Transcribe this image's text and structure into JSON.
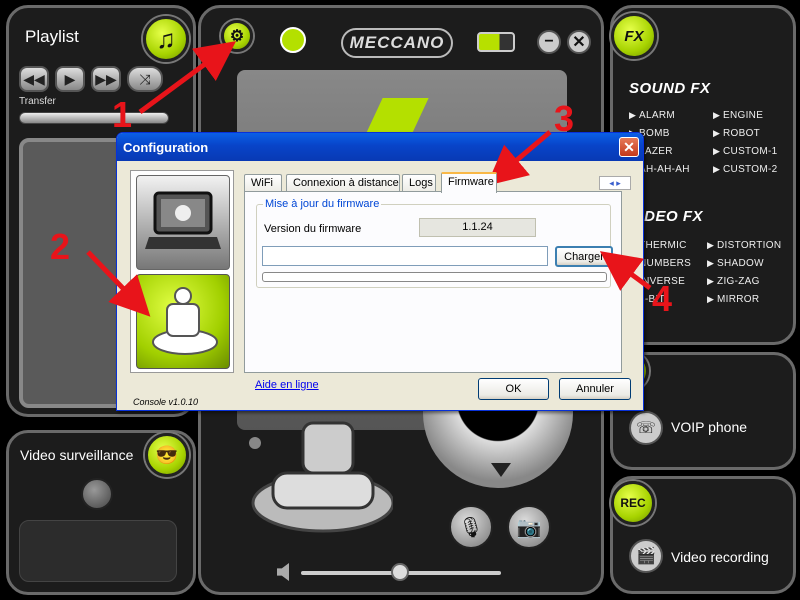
{
  "playlist": {
    "title": "Playlist",
    "transfer_label": "Transfer",
    "controls": [
      "rewind-icon",
      "play-icon",
      "fast-forward-icon",
      "shuffle-icon"
    ]
  },
  "surveillance": {
    "title": "Video surveillance"
  },
  "main": {
    "brand": "MECCANO",
    "battery_level": 0.6
  },
  "fx": {
    "sound_title": "SOUND FX",
    "sound_left": [
      "ALARM",
      "BOMB",
      "LAZER",
      "AH-AH-AH"
    ],
    "sound_right": [
      "ENGINE",
      "ROBOT",
      "CUSTOM-1",
      "CUSTOM-2"
    ],
    "video_title": "VIDEO FX",
    "video_left": [
      "THERMIC",
      "NUMBERS",
      "INVERSE",
      "8-BIT"
    ],
    "video_right": [
      "DISTORTION",
      "SHADOW",
      "ZIG-ZAG",
      "MIRROR"
    ],
    "badge": "FX"
  },
  "voip": {
    "label": "VOIP phone"
  },
  "rec": {
    "badge": "REC",
    "label": "Video recording"
  },
  "dialog": {
    "title": "Configuration",
    "close_symbol": "✕",
    "tabs": [
      "WiFi",
      "Connexion à distance",
      "Logs",
      "Firmware"
    ],
    "active_tab": "Firmware",
    "tab_scroll": "◂ ▸",
    "group_title": "Mise à jour du firmware",
    "fw_label": "Version du firmware",
    "fw_value": "1.1.24",
    "fw_path_value": "",
    "load_button": "Charger",
    "help_link": "Aide en ligne",
    "ok_button": "OK",
    "cancel_button": "Annuler",
    "console_version": "Console v1.0.10"
  },
  "annotations": {
    "n1": "1",
    "n2": "2",
    "n3": "3",
    "n4": "4",
    "color": "#e8141a"
  }
}
